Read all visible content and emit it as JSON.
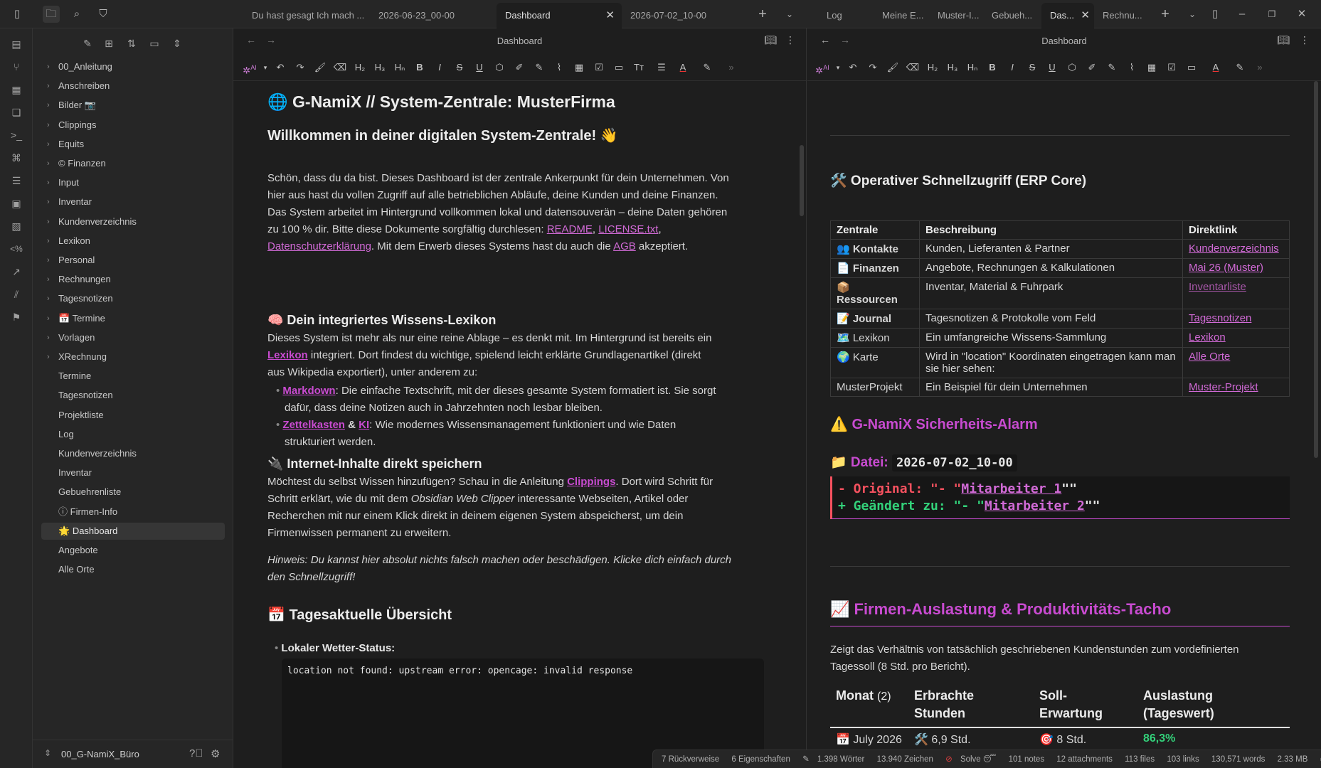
{
  "topbar": {
    "left_tabs": [
      {
        "label": "Du hast gesagt Ich mach ..."
      },
      {
        "label": "2026-06-23_00-00"
      },
      {
        "label": "Dashboard",
        "active": true
      },
      {
        "label": "2026-07-02_10-00"
      }
    ],
    "right_tabs": [
      {
        "label": "Log"
      },
      {
        "label": "Meine E..."
      },
      {
        "label": "Muster-I..."
      },
      {
        "label": "Gebueh..."
      },
      {
        "label": "Das...",
        "active": true
      },
      {
        "label": "Rechnu..."
      }
    ]
  },
  "sidebar": {
    "folders": [
      "00_Anleitung",
      "Anschreiben",
      "Bilder 📷",
      "Clippings",
      "Equits",
      "Finanzen",
      "Input",
      "Inventar",
      "Kundenverzeichnis",
      "Lexikon",
      "Personal",
      "Rechnungen",
      "Tagesnotizen",
      "Termine",
      "Vorlagen",
      "XRechnung"
    ],
    "files": [
      "Termine",
      "Tagesnotizen",
      "Projektliste",
      "Log",
      "Kundenverzeichnis",
      "Inventar",
      "Gebuehrenliste",
      "Firmen-Info",
      "Dashboard",
      "Angebote",
      "Alle Orte"
    ],
    "vault_name": "00_G-NamiX_Büro"
  },
  "left_pane": {
    "title": "Dashboard",
    "h1": "🌐 G-NamiX // System-Zentrale: MusterFirma",
    "welcome": "Willkommen in deiner digitalen System-Zentrale! 👋",
    "intro_lines": [
      "Schön, dass du da bist. Dieses Dashboard ist der zentrale Ankerpunkt für dein Unternehmen. Von",
      "hier aus hast du vollen Zugriff auf alle betrieblichen Abläufe, deine Kunden und deine Finanzen.",
      "Das System arbeitet im Hintergrund vollkommen lokal und datensouverän – deine Daten gehören"
    ],
    "intro_line4_pre": "zu 100 % dir. Bitte diese Dokumente sorgfältig durchlesen: ",
    "link_readme": "README",
    "link_license": "LICENSE.txt",
    "link_datenschutz": "Datenschutzerklärung",
    "intro_line5_mid": ". Mit dem Erwerb dieses Systems hast du auch die ",
    "link_agb": "AGB",
    "intro_line5_end": " akzeptiert.",
    "lexikon_heading": "🧠 Dein integriertes Wissens-Lexikon",
    "lexikon_line1": "Dieses System ist mehr als nur eine reine Ablage – es denkt mit. Im Hintergrund ist bereits ein",
    "lexikon_link": "Lexikon",
    "lexikon_line2_rest": " integriert. Dort findest du wichtige, spielend leicht erklärte Grundlagenartikel (direkt",
    "lexikon_line3": "aus Wikipedia exportiert), unter anderem zu:",
    "bullet1_link": "Markdown",
    "bullet1_line1": ": Die einfache Textschrift, mit der dieses gesamte System formatiert ist. Sie sorgt",
    "bullet1_line2": "dafür, dass deine Notizen auch in Jahrzehnten noch lesbar bleiben.",
    "bullet2_link1": "Zettelkasten",
    "bullet2_amp": " & ",
    "bullet2_link2": "KI",
    "bullet2_line1": ": Wie modernes Wissensmanagement funktioniert und wie Daten",
    "bullet2_line2": "strukturiert werden.",
    "internet_heading": "🔌 Internet-Inhalte direkt speichern",
    "internet_line1_pre": "Möchtest du selbst Wissen hinzufügen? Schau in die Anleitung ",
    "internet_link": "Clippings",
    "internet_line1_end": ". Dort wird Schritt für",
    "internet_line2_pre": "Schritt erklärt, wie du mit dem ",
    "internet_line2_em": "Obsidian Web Clipper",
    "internet_line2_end": " interessante Webseiten, Artikel oder",
    "internet_line3": "Recherchen mit nur einem Klick direkt in deinem eigenen System abspeicherst, um dein",
    "internet_line4": "Firmenwissen permanent zu erweitern.",
    "hint_line1": "Hinweis: Du kannst hier absolut nichts falsch machen oder beschädigen. Klicke dich einfach durch",
    "hint_line2": "den Schnellzugriff!",
    "today_heading": "📅 Tagesaktuelle Übersicht",
    "weather_label": "Lokaler Wetter-Status:",
    "weather_code": "location not found: upstream error: opencage: invalid response"
  },
  "right_pane": {
    "title": "Dashboard",
    "erp_heading": "🛠️ Operativer Schnellzugriff (ERP Core)",
    "erp_headers": [
      "Zentrale",
      "Beschreibung",
      "Direktlink"
    ],
    "erp_rows": [
      {
        "zentrale": "👥 Kontakte",
        "bold": true,
        "desc": "Kunden, Lieferanten & Partner",
        "link": "Kundenverzeichnis",
        "dim": false
      },
      {
        "zentrale": "📄 Finanzen",
        "bold": true,
        "desc": "Angebote, Rechnungen & Kalkulationen",
        "link": "Mai 26 (Muster)",
        "dim": false
      },
      {
        "zentrale": "📦 Ressourcen",
        "bold": true,
        "desc": "Inventar, Material & Fuhrpark",
        "link": "Inventarliste",
        "dim": true
      },
      {
        "zentrale": "📝 Journal",
        "bold": true,
        "desc": "Tagesnotizen & Protokolle vom Feld",
        "link": "Tagesnotizen",
        "dim": false
      },
      {
        "zentrale": "🗺️ Lexikon",
        "bold": false,
        "desc": "Ein umfangreiche Wissens-Sammlung",
        "link": "Lexikon",
        "dim": false
      },
      {
        "zentrale": "🌍 Karte",
        "bold": false,
        "desc": "Wird in \"location\" Koordinaten eingetragen kann man sie hier sehen:",
        "link": "Alle Orte",
        "dim": false
      },
      {
        "zentrale": "MusterProjekt",
        "bold": false,
        "desc": "Ein Beispiel für dein Unternehmen",
        "link": "Muster-Projekt",
        "dim": false
      }
    ],
    "alarm_heading": "⚠️ G-NamiX Sicherheits-Alarm",
    "datei_label": "📁 Datei:",
    "datei_value": "2026-07-02_10-00",
    "diff_original_pre": "- Original: \"- \"",
    "diff_original_link": "Mitarbeiter 1",
    "diff_original_end": "\"\"",
    "diff_changed_pre": "+ Geändert zu: \"- \"",
    "diff_changed_link": "Mitarbeiter 2",
    "diff_changed_end": "\"\"",
    "tacho_heading": "📈 Firmen-Auslastung & Produktivitäts-Tacho",
    "tacho_desc_line1": "Zeigt das Verhältnis von tatsächlich geschriebenen Kundenstunden zum vordefinierten",
    "tacho_desc_line2": "Tagessoll (8 Std. pro Bericht).",
    "tacho_headers": {
      "monat": "Monat",
      "monat_count": "(2)",
      "erbracht_1": "Erbrachte",
      "erbracht_2": "Stunden",
      "soll_1": "Soll-",
      "soll_2": "Erwartung",
      "ausl_1": "Auslastung",
      "ausl_2": "(Tageswert)"
    },
    "tacho_row": {
      "monat": "📅 July 2026",
      "erbracht": "🛠️ 6,9 Std.",
      "soll": "🎯 8 Std.",
      "ausl": "86,3%"
    }
  },
  "status": {
    "backlinks": "7 Rückverweise",
    "props": "6 Eigenschaften",
    "words": "1.398 Wörter",
    "chars": "13.940 Zeichen",
    "solve": "Solve 😴",
    "notes": "101 notes",
    "attachments": "12 attachments",
    "files": "113 files",
    "links": "103 links",
    "total_words": "130,571 words",
    "size": "2.33 MB"
  },
  "colors": {
    "accent": "#c84bd0",
    "link": "#d16ad6",
    "green": "#33d17a",
    "diff_red": "#f5515f"
  }
}
